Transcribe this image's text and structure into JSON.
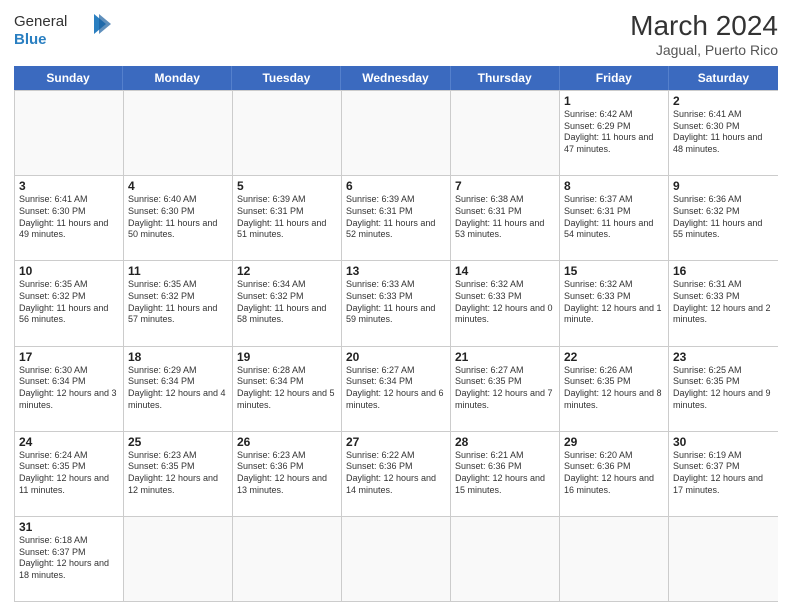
{
  "header": {
    "logo_general": "General",
    "logo_blue": "Blue",
    "month_title": "March 2024",
    "location": "Jagual, Puerto Rico"
  },
  "days_of_week": [
    "Sunday",
    "Monday",
    "Tuesday",
    "Wednesday",
    "Thursday",
    "Friday",
    "Saturday"
  ],
  "weeks": [
    [
      {
        "day": "",
        "empty": true
      },
      {
        "day": "",
        "empty": true
      },
      {
        "day": "",
        "empty": true
      },
      {
        "day": "",
        "empty": true
      },
      {
        "day": "",
        "empty": true
      },
      {
        "day": "1",
        "sunrise": "6:42 AM",
        "sunset": "6:29 PM",
        "daylight": "11 hours and 47 minutes."
      },
      {
        "day": "2",
        "sunrise": "6:41 AM",
        "sunset": "6:30 PM",
        "daylight": "11 hours and 48 minutes."
      }
    ],
    [
      {
        "day": "3",
        "sunrise": "6:41 AM",
        "sunset": "6:30 PM",
        "daylight": "11 hours and 49 minutes."
      },
      {
        "day": "4",
        "sunrise": "6:40 AM",
        "sunset": "6:30 PM",
        "daylight": "11 hours and 50 minutes."
      },
      {
        "day": "5",
        "sunrise": "6:39 AM",
        "sunset": "6:31 PM",
        "daylight": "11 hours and 51 minutes."
      },
      {
        "day": "6",
        "sunrise": "6:39 AM",
        "sunset": "6:31 PM",
        "daylight": "11 hours and 52 minutes."
      },
      {
        "day": "7",
        "sunrise": "6:38 AM",
        "sunset": "6:31 PM",
        "daylight": "11 hours and 53 minutes."
      },
      {
        "day": "8",
        "sunrise": "6:37 AM",
        "sunset": "6:31 PM",
        "daylight": "11 hours and 54 minutes."
      },
      {
        "day": "9",
        "sunrise": "6:36 AM",
        "sunset": "6:32 PM",
        "daylight": "11 hours and 55 minutes."
      }
    ],
    [
      {
        "day": "10",
        "sunrise": "6:35 AM",
        "sunset": "6:32 PM",
        "daylight": "11 hours and 56 minutes."
      },
      {
        "day": "11",
        "sunrise": "6:35 AM",
        "sunset": "6:32 PM",
        "daylight": "11 hours and 57 minutes."
      },
      {
        "day": "12",
        "sunrise": "6:34 AM",
        "sunset": "6:32 PM",
        "daylight": "11 hours and 58 minutes."
      },
      {
        "day": "13",
        "sunrise": "6:33 AM",
        "sunset": "6:33 PM",
        "daylight": "11 hours and 59 minutes."
      },
      {
        "day": "14",
        "sunrise": "6:32 AM",
        "sunset": "6:33 PM",
        "daylight": "12 hours and 0 minutes."
      },
      {
        "day": "15",
        "sunrise": "6:32 AM",
        "sunset": "6:33 PM",
        "daylight": "12 hours and 1 minute."
      },
      {
        "day": "16",
        "sunrise": "6:31 AM",
        "sunset": "6:33 PM",
        "daylight": "12 hours and 2 minutes."
      }
    ],
    [
      {
        "day": "17",
        "sunrise": "6:30 AM",
        "sunset": "6:34 PM",
        "daylight": "12 hours and 3 minutes."
      },
      {
        "day": "18",
        "sunrise": "6:29 AM",
        "sunset": "6:34 PM",
        "daylight": "12 hours and 4 minutes."
      },
      {
        "day": "19",
        "sunrise": "6:28 AM",
        "sunset": "6:34 PM",
        "daylight": "12 hours and 5 minutes."
      },
      {
        "day": "20",
        "sunrise": "6:27 AM",
        "sunset": "6:34 PM",
        "daylight": "12 hours and 6 minutes."
      },
      {
        "day": "21",
        "sunrise": "6:27 AM",
        "sunset": "6:35 PM",
        "daylight": "12 hours and 7 minutes."
      },
      {
        "day": "22",
        "sunrise": "6:26 AM",
        "sunset": "6:35 PM",
        "daylight": "12 hours and 8 minutes."
      },
      {
        "day": "23",
        "sunrise": "6:25 AM",
        "sunset": "6:35 PM",
        "daylight": "12 hours and 9 minutes."
      }
    ],
    [
      {
        "day": "24",
        "sunrise": "6:24 AM",
        "sunset": "6:35 PM",
        "daylight": "12 hours and 11 minutes."
      },
      {
        "day": "25",
        "sunrise": "6:23 AM",
        "sunset": "6:35 PM",
        "daylight": "12 hours and 12 minutes."
      },
      {
        "day": "26",
        "sunrise": "6:23 AM",
        "sunset": "6:36 PM",
        "daylight": "12 hours and 13 minutes."
      },
      {
        "day": "27",
        "sunrise": "6:22 AM",
        "sunset": "6:36 PM",
        "daylight": "12 hours and 14 minutes."
      },
      {
        "day": "28",
        "sunrise": "6:21 AM",
        "sunset": "6:36 PM",
        "daylight": "12 hours and 15 minutes."
      },
      {
        "day": "29",
        "sunrise": "6:20 AM",
        "sunset": "6:36 PM",
        "daylight": "12 hours and 16 minutes."
      },
      {
        "day": "30",
        "sunrise": "6:19 AM",
        "sunset": "6:37 PM",
        "daylight": "12 hours and 17 minutes."
      }
    ],
    [
      {
        "day": "31",
        "sunrise": "6:18 AM",
        "sunset": "6:37 PM",
        "daylight": "12 hours and 18 minutes."
      },
      {
        "day": "",
        "empty": true
      },
      {
        "day": "",
        "empty": true
      },
      {
        "day": "",
        "empty": true
      },
      {
        "day": "",
        "empty": true
      },
      {
        "day": "",
        "empty": true
      },
      {
        "day": "",
        "empty": true
      }
    ]
  ]
}
